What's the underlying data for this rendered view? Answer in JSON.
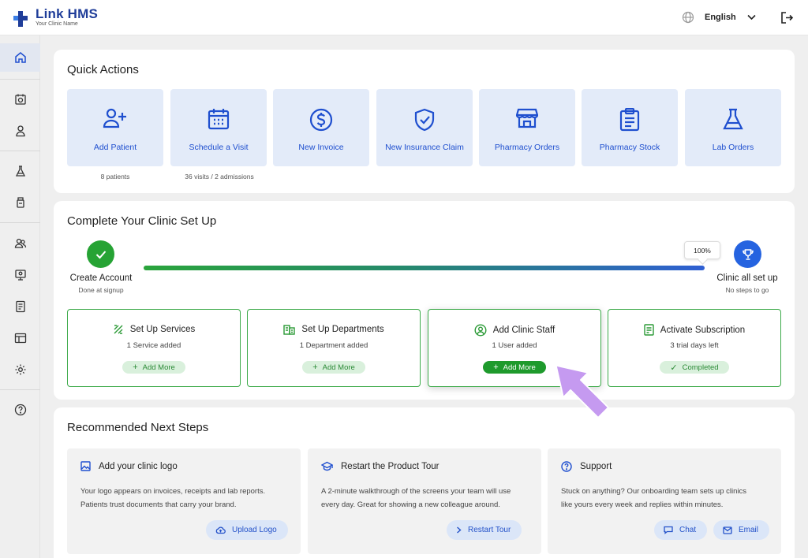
{
  "app": {
    "name": "Link HMS",
    "subtitle": "Your Clinic Name"
  },
  "header": {
    "language": "English"
  },
  "sidebar": {
    "items": [
      "home-icon",
      "calendar-icon",
      "user-icon",
      "flask-icon",
      "bottle-icon",
      "users-icon",
      "monitor-icon",
      "report-icon",
      "table-icon",
      "gear-icon",
      "help-icon"
    ]
  },
  "quick_actions": {
    "title": "Quick Actions",
    "items": [
      {
        "label": "Add Patient",
        "icon": "user-plus-icon",
        "stat": "8 patients"
      },
      {
        "label": "Schedule a Visit",
        "icon": "calendar-grid-icon",
        "stat": "36 visits / 2 admissions"
      },
      {
        "label": "New Invoice",
        "icon": "dollar-icon",
        "stat": ""
      },
      {
        "label": "New Insurance Claim",
        "icon": "shield-check-icon",
        "stat": ""
      },
      {
        "label": "Pharmacy Orders",
        "icon": "store-icon",
        "stat": ""
      },
      {
        "label": "Pharmacy Stock",
        "icon": "clipboard-icon",
        "stat": ""
      },
      {
        "label": "Lab Orders",
        "icon": "flask-icon",
        "stat": ""
      }
    ]
  },
  "setup": {
    "title": "Complete Your Clinic Set Up",
    "start": {
      "title": "Create Account",
      "sub": "Done at signup"
    },
    "end": {
      "title": "Clinic all set up",
      "sub": "No steps to go"
    },
    "progress_percent": 100,
    "progress_label": "100%",
    "tasks": [
      {
        "title": "Set Up Services",
        "sub": "1 Service added",
        "action": "Add More",
        "icon": "services-icon",
        "state": "add"
      },
      {
        "title": "Set Up Departments",
        "sub": "1 Department added",
        "action": "Add More",
        "icon": "departments-icon",
        "state": "add"
      },
      {
        "title": "Add Clinic Staff",
        "sub": "1 User added",
        "action": "Add More",
        "icon": "staff-icon",
        "state": "add-active"
      },
      {
        "title": "Activate Subscription",
        "sub": "3 trial days left",
        "action": "Completed",
        "icon": "subscription-icon",
        "state": "done"
      }
    ]
  },
  "recommended": {
    "title": "Recommended Next Steps",
    "items": [
      {
        "title": "Add your clinic logo",
        "body_1": "Your logo appears on invoices, receipts and lab reports.",
        "body_2": "Patients trust documents that carry your brand.",
        "buttons": [
          "Upload Logo"
        ]
      },
      {
        "title": "Restart the Product Tour",
        "body_1": "A 2-minute walkthrough of the screens your team will use",
        "body_2": "every day. Great for showing a new colleague around.",
        "buttons": [
          "Restart Tour"
        ]
      },
      {
        "title": "Support",
        "body_1": "Stuck on anything? Our onboarding team sets up clinics",
        "body_2": "like yours every week and replies within minutes.",
        "buttons": [
          "Chat",
          "Email"
        ]
      }
    ]
  },
  "colors": {
    "brand_blue": "#1f4fcf",
    "brand_green": "#1e9a2c",
    "tile_bg": "#e3ebf9",
    "pointer": "#c59af0"
  }
}
